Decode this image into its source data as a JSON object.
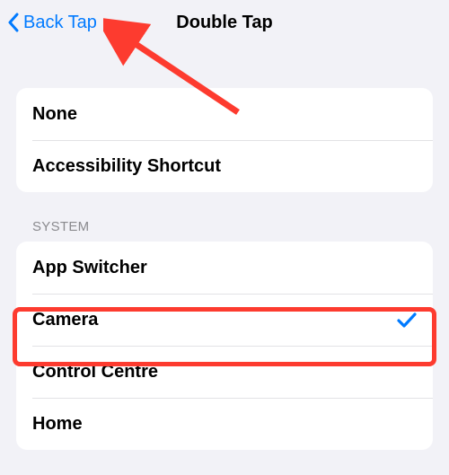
{
  "nav": {
    "back_label": "Back Tap",
    "title": "Double Tap"
  },
  "group1": {
    "items": [
      {
        "label": "None",
        "selected": false
      },
      {
        "label": "Accessibility Shortcut",
        "selected": false
      }
    ]
  },
  "section_system": {
    "header": "SYSTEM",
    "items": [
      {
        "label": "App Switcher",
        "selected": false
      },
      {
        "label": "Camera",
        "selected": true
      },
      {
        "label": "Control Centre",
        "selected": false
      },
      {
        "label": "Home",
        "selected": false
      }
    ]
  },
  "annotations": {
    "arrow_target": "back-button",
    "highlight_row": "Camera",
    "color": "#fd3b2f"
  }
}
